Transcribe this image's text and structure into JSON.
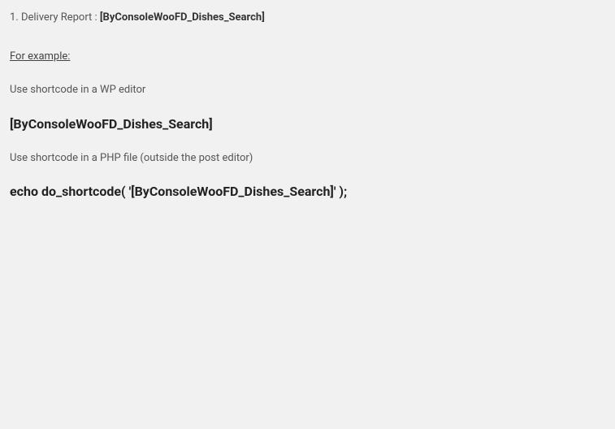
{
  "listItem": {
    "number": "1.",
    "label": "Delivery Report :",
    "shortcode": "[ByConsoleWooFD_Dishes_Search]"
  },
  "exampleHeading": "For example:",
  "instruction1": "Use shortcode in a WP editor",
  "shortcodeDisplay": "[ByConsoleWooFD_Dishes_Search]",
  "instruction2": "Use shortcode in a PHP file (outside the post editor)",
  "codeDisplay": "echo do_shortcode( '[ByConsoleWooFD_Dishes_Search]' );"
}
